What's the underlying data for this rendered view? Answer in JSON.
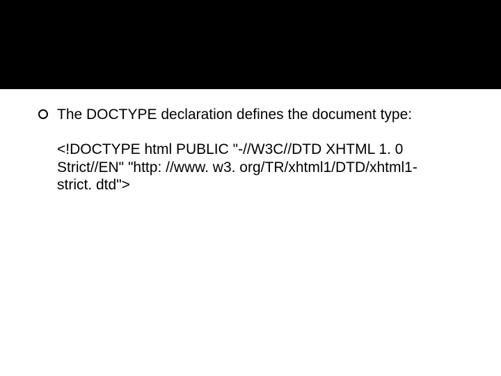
{
  "slide": {
    "bullet": {
      "text": "The DOCTYPE declaration defines the document type:"
    },
    "code": {
      "line1": "<!DOCTYPE html PUBLIC \"-//W3C//DTD XHTML 1. 0",
      "line2": "Strict//EN\" \"http: //www. w3. org/TR/xhtml1/DTD/xhtml1-",
      "line3": "strict. dtd\">"
    }
  }
}
